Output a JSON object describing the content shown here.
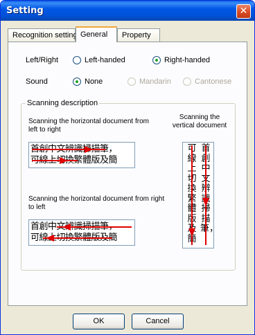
{
  "window": {
    "title": "Setting",
    "close_glyph": "✕"
  },
  "tabs": [
    {
      "label": "Recognition setting",
      "active": false
    },
    {
      "label": "General",
      "active": true
    },
    {
      "label": "Property",
      "active": false
    }
  ],
  "hand": {
    "label": "Left/Right",
    "options": [
      {
        "label": "Left-handed",
        "checked": false,
        "enabled": true
      },
      {
        "label": "Right-handed",
        "checked": true,
        "enabled": true
      }
    ]
  },
  "sound": {
    "label": "Sound",
    "options": [
      {
        "label": "None",
        "checked": true,
        "enabled": true
      },
      {
        "label": "Mandarin",
        "checked": false,
        "enabled": false
      },
      {
        "label": "Cantonese",
        "checked": false,
        "enabled": false
      }
    ]
  },
  "scanning": {
    "group_title": "Scanning description",
    "ltr_desc": "Scanning the horizontal document from left to right",
    "rtl_desc": "Scanning the horizontal document from right to left",
    "vertical_desc": "Scanning the vertical document",
    "sample_line1": "首創中文辨識掃描筆，",
    "sample_line2": "可線上切換繁體版及簡",
    "arrow_color": "#e00000"
  },
  "buttons": {
    "ok": "OK",
    "cancel": "Cancel"
  }
}
